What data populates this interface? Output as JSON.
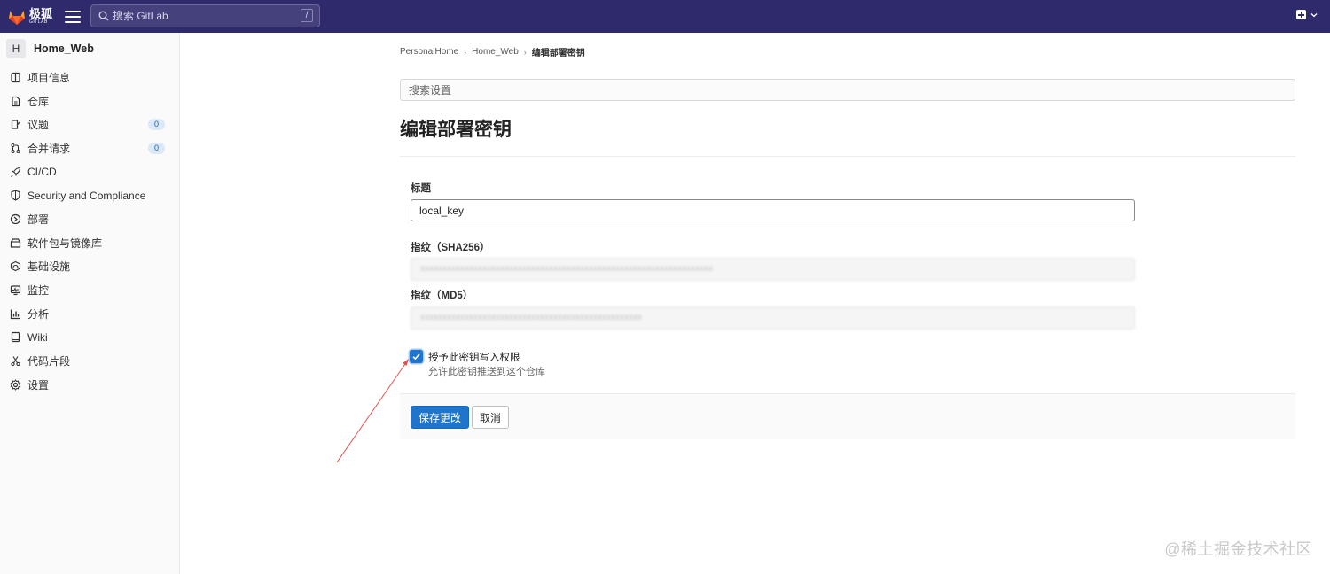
{
  "topbar": {
    "brand_name": "极狐",
    "brand_sub": "GITLAB",
    "search_placeholder": "搜索 GitLab",
    "search_shortcut": "/",
    "accent": "#2f2a6b"
  },
  "sidebar": {
    "project_initial": "H",
    "project_name": "Home_Web",
    "items": [
      {
        "label": "项目信息",
        "icon": "project-info-icon"
      },
      {
        "label": "仓库",
        "icon": "document-icon"
      },
      {
        "label": "议题",
        "icon": "issues-icon",
        "badge": "0"
      },
      {
        "label": "合并请求",
        "icon": "merge-request-icon",
        "badge": "0"
      },
      {
        "label": "CI/CD",
        "icon": "rocket-icon"
      },
      {
        "label": "Security and Compliance",
        "icon": "shield-icon"
      },
      {
        "label": "部署",
        "icon": "deployments-icon"
      },
      {
        "label": "软件包与镜像库",
        "icon": "package-icon"
      },
      {
        "label": "基础设施",
        "icon": "cloud-icon"
      },
      {
        "label": "监控",
        "icon": "monitor-icon"
      },
      {
        "label": "分析",
        "icon": "chart-icon"
      },
      {
        "label": "Wiki",
        "icon": "book-icon"
      },
      {
        "label": "代码片段",
        "icon": "snippet-icon"
      },
      {
        "label": "设置",
        "icon": "gear-icon"
      }
    ]
  },
  "breadcrumb": {
    "items": [
      "PersonalHome",
      "Home_Web"
    ],
    "current": "编辑部署密钥"
  },
  "settings_search": {
    "placeholder": "搜索设置"
  },
  "page": {
    "title": "编辑部署密钥"
  },
  "form": {
    "title_label": "标题",
    "title_value": "local_key",
    "sha256_label": "指纹（SHA256）",
    "sha256_value": "xxxxxxxxxxxxxxxxxxxxxxxxxxxxxxxxxxxxxxxxxxxxxxxxxxxxxxxxxxxxxxxxxx",
    "md5_label": "指纹（MD5）",
    "md5_value": "xxxxxxxxxxxxxxxxxxxxxxxxxxxxxxxxxxxxxxxxxxxxxxxxxx",
    "write_access_label": "授予此密钥写入权限",
    "write_access_help": "允许此密钥推送到这个仓库",
    "write_access_checked": true,
    "save_label": "保存更改",
    "cancel_label": "取消",
    "primary_color": "#1f75cb"
  },
  "watermark": "@稀土掘金技术社区"
}
